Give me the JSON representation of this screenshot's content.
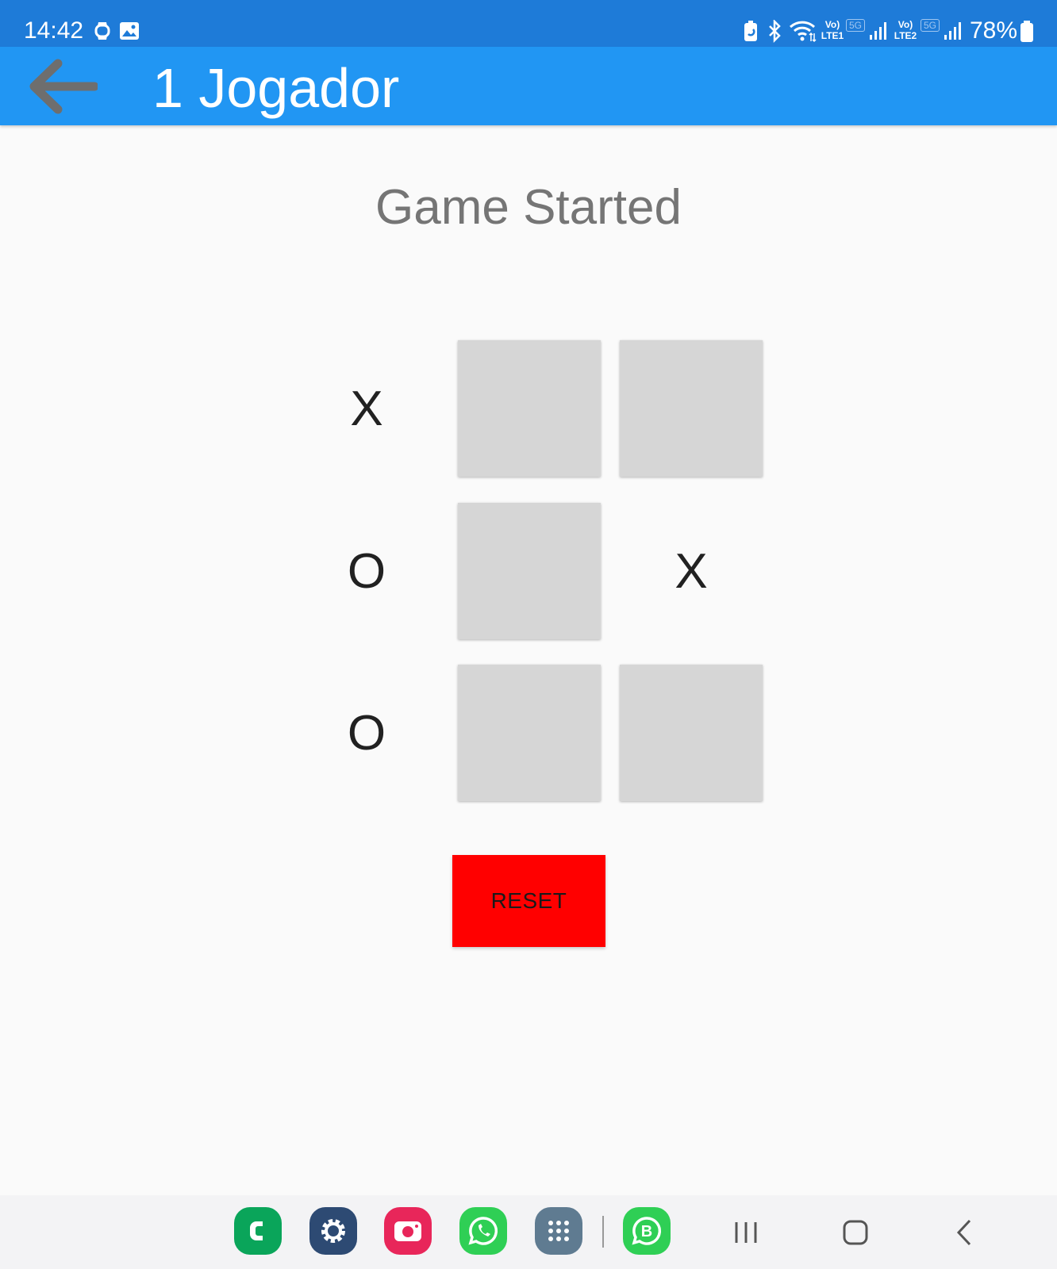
{
  "status_bar": {
    "time": "14:42",
    "battery": "78%",
    "network_labels": [
      "Vo)",
      "LTE1",
      "5G",
      "Vo)",
      "LTE2",
      "5G"
    ],
    "icons": [
      "watch-icon",
      "gallery-icon",
      "battery-saver-icon",
      "bluetooth-icon",
      "wifi-icon",
      "signal-icon",
      "battery-icon"
    ]
  },
  "app_bar": {
    "title": "1 Jogador",
    "back_icon": "arrow-left-icon",
    "color": "#2196f3"
  },
  "game": {
    "status": "Game Started",
    "board": [
      [
        "X",
        "",
        ""
      ],
      [
        "O",
        "",
        "X"
      ],
      [
        "O",
        "",
        ""
      ]
    ]
  },
  "reset": {
    "label": "RESET",
    "color": "#ff0000"
  },
  "dock": {
    "apps": [
      "phone-app-icon",
      "settings-app-icon",
      "camera-app-icon",
      "whatsapp-app-icon",
      "app-drawer-icon",
      "whatsapp-business-app-icon"
    ]
  },
  "nav": {
    "buttons": [
      "recents-icon",
      "home-icon",
      "back-nav-icon"
    ]
  }
}
